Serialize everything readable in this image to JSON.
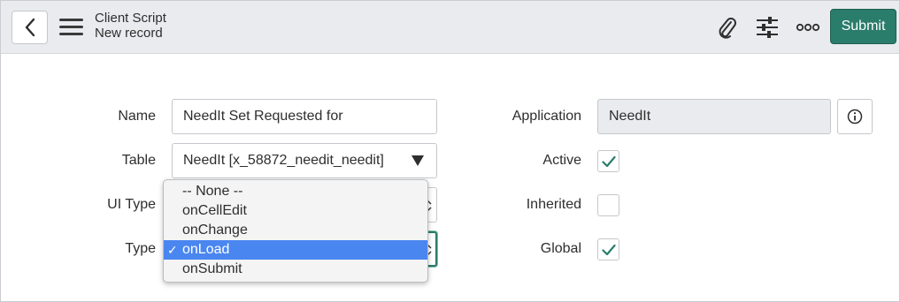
{
  "header": {
    "title": "Client Script",
    "subtitle": "New record",
    "submit_label": "Submit"
  },
  "form": {
    "name": {
      "label": "Name",
      "value": "NeedIt Set Requested for"
    },
    "table": {
      "label": "Table",
      "value": "NeedIt [x_58872_needit_needit]"
    },
    "ui_type": {
      "label": "UI Type"
    },
    "type": {
      "label": "Type"
    },
    "application": {
      "label": "Application",
      "value": "NeedIt"
    },
    "active": {
      "label": "Active",
      "checked": true
    },
    "inherited": {
      "label": "Inherited",
      "checked": false
    },
    "global": {
      "label": "Global",
      "checked": true
    }
  },
  "type_dropdown": {
    "options": [
      "-- None --",
      "onCellEdit",
      "onChange",
      "onLoad",
      "onSubmit"
    ],
    "selected": "onLoad",
    "check_glyph": "✓"
  },
  "colors": {
    "accent": "#2a7c6b",
    "selection": "#4a86f0",
    "header_bg": "#e9ebee"
  },
  "icons": [
    "back-icon",
    "hamburger-menu-icon",
    "paperclip-icon",
    "sliders-icon",
    "more-icon",
    "info-icon",
    "check-icon",
    "dropdown-caret-icon"
  ]
}
